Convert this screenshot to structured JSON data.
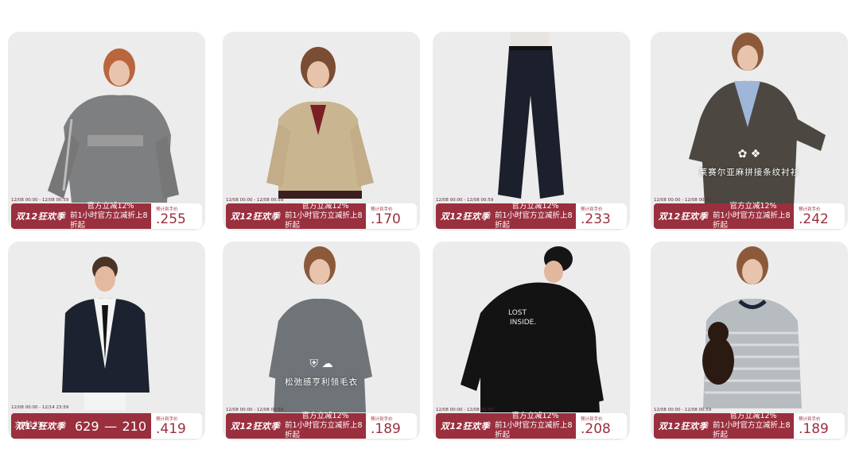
{
  "products": [
    {
      "promo_tag": "双12狂欢季",
      "line1": "官方立减12%",
      "line2": "前1小时官方立减折上8折起",
      "date_range": "12/08 00:00 - 12/08 00:59",
      "price_label": "预计到手价",
      "price": ".255",
      "caption": ""
    },
    {
      "promo_tag": "双12狂欢季",
      "line1": "官方立减12%",
      "line2": "前1小时官方立减折上8折起",
      "date_range": "12/08 00:00 - 12/08 00:59",
      "price_label": "预计到手价",
      "price": ".170",
      "caption": ""
    },
    {
      "promo_tag": "双12狂欢季",
      "line1": "官方立减12%",
      "line2": "前1小时官方立减折上8折起",
      "date_range": "12/08 00:00 - 12/08 00:59",
      "price_label": "预计到手价",
      "price": ".233",
      "caption": ""
    },
    {
      "promo_tag": "双12狂欢季",
      "line1": "官方立减12%",
      "line2": "前1小时官方立减折上8折起",
      "date_range": "12/08 00:00 - 12/08 00:59",
      "price_label": "预计到手价",
      "price": ".242",
      "caption": "莱赛尔亚麻拼接条纹衬衫"
    },
    {
      "promo_tag": "双12狂欢季",
      "line1": "立减12%",
      "line2": "",
      "date_range": "12/08 00:00 - 12/14 23:59",
      "price_label": "预计到手价",
      "price": ".419",
      "orig": "629",
      "sep": "—",
      "mid_price": "210",
      "caption": ""
    },
    {
      "promo_tag": "双12狂欢季",
      "line1": "官方立减12%",
      "line2": "前1小时官方立减折上8折起",
      "date_range": "12/08 00:00 - 12/08 00:59",
      "price_label": "预计到手价",
      "price": ".189",
      "caption": "松弛感亨利领毛衣"
    },
    {
      "promo_tag": "双12狂欢季",
      "line1": "官方立减12%",
      "line2": "前1小时官方立减折上8折起",
      "date_range": "12/08 00:00 - 12/08 00:59",
      "price_label": "预计到手价",
      "price": ".208",
      "caption": ""
    },
    {
      "promo_tag": "双12狂欢季",
      "line1": "官方立减12%",
      "line2": "前1小时官方立减折上8折起",
      "date_range": "12/08 00:00 - 12/08 00:59",
      "price_label": "预计到手价",
      "price": ".189",
      "caption": ""
    }
  ],
  "colors": {
    "banner": "#9a2f3e",
    "card_bg": "#ececec"
  }
}
